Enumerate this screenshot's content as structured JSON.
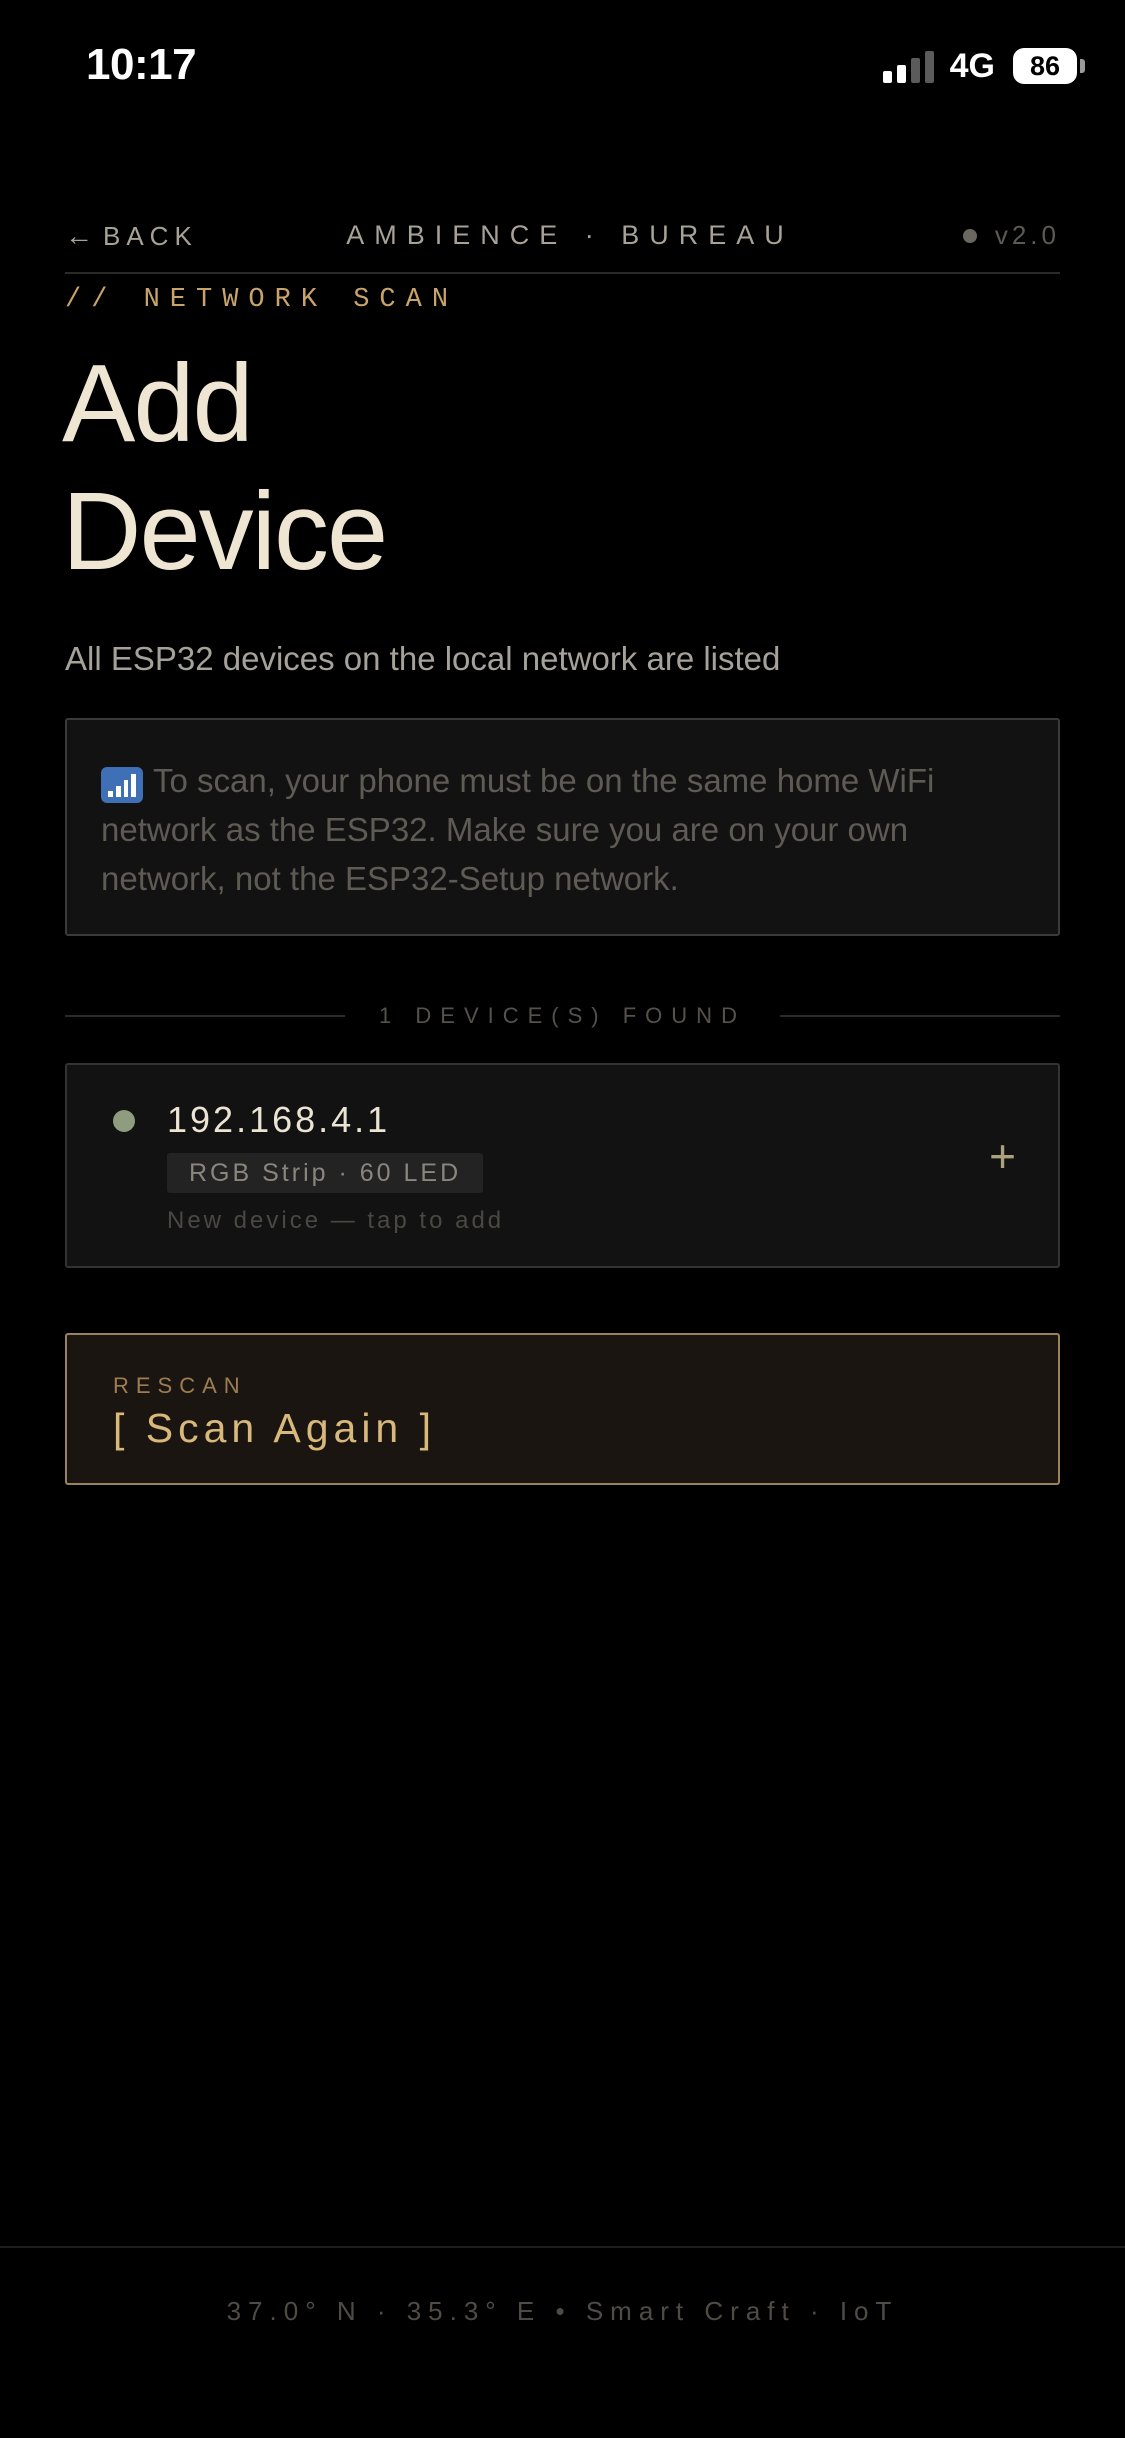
{
  "status_bar": {
    "time": "10:17",
    "network": "4G",
    "battery": "86"
  },
  "header": {
    "back_label": "BACK",
    "back_icon": "arrow-left-icon",
    "brand": "AMBIENCE · BUREAU",
    "version": "v2.0"
  },
  "page": {
    "section_tag": "// NETWORK SCAN",
    "title_line1": "Add",
    "title_line2": "Device",
    "subtitle": "All ESP32 devices on the local network are listed"
  },
  "info": {
    "icon": "signal-bars-icon",
    "text": "To scan, your phone must be on the same home WiFi network as the ESP32. Make sure you are on your own network, not the ESP32-Setup network."
  },
  "results": {
    "count_label": "1 DEVICE(S) FOUND",
    "devices": [
      {
        "ip": "192.168.4.1",
        "type": "RGB Strip · 60 LED",
        "hint": "New device — tap to add",
        "status_color": "#8f9c7e"
      }
    ]
  },
  "rescan": {
    "label": "RESCAN",
    "button_text": "[ Scan Again ]"
  },
  "footer": {
    "text": "37.0° N · 35.3° E  •  Smart Craft · IoT"
  },
  "colors": {
    "accent_gold": "#d8b87b",
    "background": "#000000",
    "text_primary": "#ece4d2"
  }
}
